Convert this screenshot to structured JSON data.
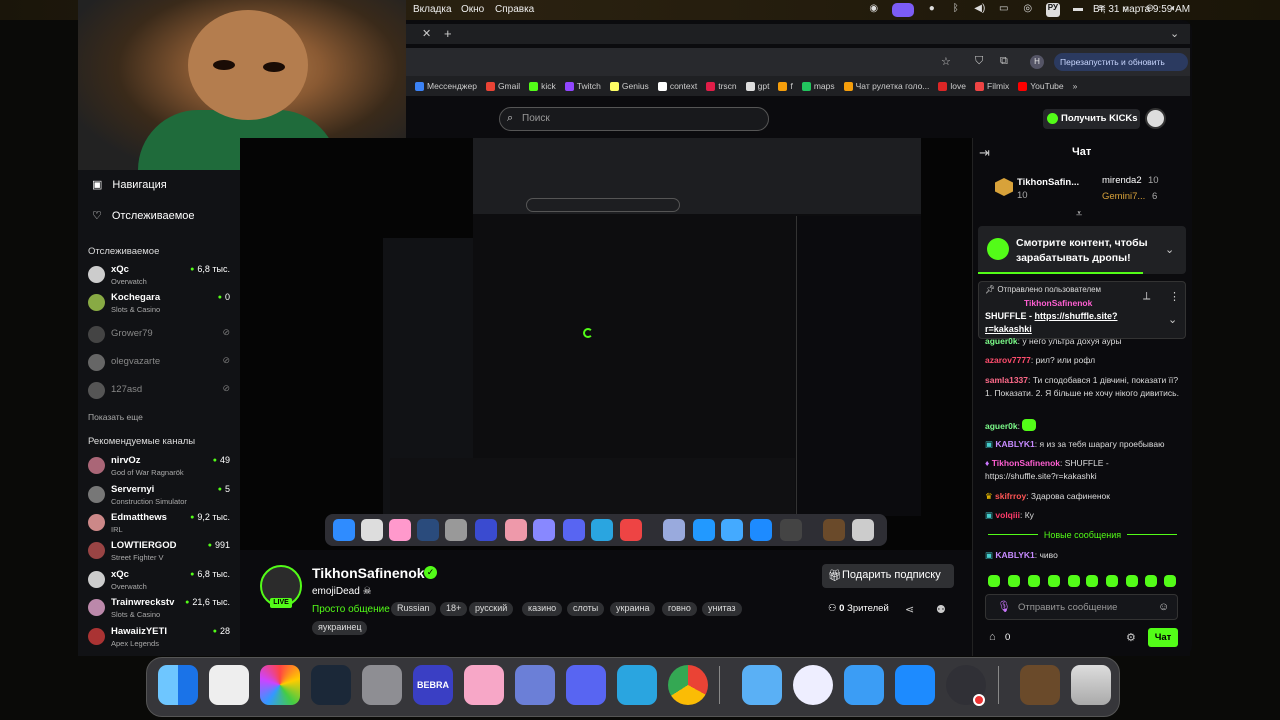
{
  "menubar": {
    "tab": "Вкладка",
    "window": "Окно",
    "help": "Справка",
    "lang": "РУ",
    "datetime": "Вт, 31 марта  9:59 AM"
  },
  "browser": {
    "restart_button": "Перезапустить и обновить",
    "bookmarks": [
      {
        "label": "Мессенджер",
        "color": "#3b82f6"
      },
      {
        "label": "Gmail",
        "color": "#ea4335"
      },
      {
        "label": "kick",
        "color": "#53fc18"
      },
      {
        "label": "Twitch",
        "color": "#9146ff"
      },
      {
        "label": "Genius",
        "color": "#ffff64"
      },
      {
        "label": "context",
        "color": "#ffffff"
      },
      {
        "label": "trscn",
        "color": "#e11d48"
      },
      {
        "label": "gpt",
        "color": "#dddddd"
      },
      {
        "label": "f",
        "color": "#f59e0b"
      },
      {
        "label": "maps",
        "color": "#22c55e"
      },
      {
        "label": "Чат рулетка голо...",
        "color": "#f59e0b"
      },
      {
        "label": "love",
        "color": "#dc2626"
      },
      {
        "label": "Filmix",
        "color": "#ef4444"
      },
      {
        "label": "YouTube",
        "color": "#ff0000"
      }
    ]
  },
  "kick": {
    "search_placeholder": "Поиск",
    "get_kicks": "Получить KICKs"
  },
  "sidebar": {
    "nav_label": "Навигация",
    "following_label": "Отслеживаемое",
    "following_title": "Отслеживаемое",
    "following": [
      {
        "name": "xQc",
        "game": "Overwatch",
        "viewers": "6,8 тыс."
      },
      {
        "name": "Kochegara",
        "game": "Slots & Casino",
        "viewers": "0"
      }
    ],
    "offline": [
      {
        "name": "Grower79"
      },
      {
        "name": "olegvazarte"
      },
      {
        "name": "127asd"
      }
    ],
    "show_more": "Показать еще",
    "recommended_title": "Рекомендуемые каналы",
    "recommended": [
      {
        "name": "nirvOz",
        "game": "God of War Ragnarök",
        "viewers": "49"
      },
      {
        "name": "Servernyi",
        "game": "Construction Simulator",
        "viewers": "5"
      },
      {
        "name": "Edmatthews",
        "game": "IRL",
        "viewers": "9,2 тыс."
      },
      {
        "name": "LOWTIERGOD",
        "game": "Street Fighter V",
        "viewers": "991"
      },
      {
        "name": "xQc",
        "game": "Overwatch",
        "viewers": "6,8 тыс."
      },
      {
        "name": "Trainwreckstv",
        "game": "Slots & Casino",
        "viewers": "21,6 тыс."
      },
      {
        "name": "HawaiizYETI",
        "game": "Apex Legends",
        "viewers": "28"
      }
    ]
  },
  "stream": {
    "name": "TikhonSafinenok",
    "title": "emojiDead ☠",
    "category": "Просто общение",
    "tags": [
      "Russian",
      "18+",
      "русский",
      "казино",
      "слоты",
      "украина",
      "говно",
      "унитаз",
      "яукраинец"
    ],
    "live": "LIVE",
    "subscribe": "Подарить подписку",
    "viewers_count": "0",
    "viewers_label": "Зрителей"
  },
  "chat": {
    "title": "Чат",
    "leaders": [
      {
        "name": "TikhonSafin...",
        "count": "10"
      },
      {
        "name": "mirenda2",
        "count": "10"
      },
      {
        "name": "Gemini7...",
        "count": "6"
      }
    ],
    "drops_text": "Смотрите контент, чтобы зарабатывать дропы!",
    "pinned_by": "Отправлено пользователем",
    "pinned_user": "TikhonSafinenok",
    "pinned_text": "SHUFFLE - ",
    "pinned_link": "https://shuffle.site?r=kakashki",
    "messages": [
      {
        "user": "aguer0k",
        "color": "#7cfc8a",
        "text": ": у него ультра дохуя ауры"
      },
      {
        "user": "azarov7777",
        "color": "#ff4d6d",
        "text": ": рил? или рофл"
      },
      {
        "user": "samla1337",
        "color": "#ff6b8a",
        "text": ": Ти сподобався 1 дівчині, показати її? 1. Показати. 2. Я більше не хочу нікого дивитись."
      },
      {
        "user": "aguer0k",
        "color": "#7cfc8a",
        "text": ":"
      },
      {
        "user": "KABLYK1",
        "color": "#c78bff",
        "text": ": я из за тебя шарагу проебываю"
      },
      {
        "user": "TikhonSafinenok",
        "color": "#ff5fd2",
        "text": ": SHUFFLE - https://shuffle.site?r=kakashki"
      },
      {
        "user": "skifrroy",
        "color": "#ff5555",
        "text": ": Здарова сафиненок"
      },
      {
        "user": "volqiii",
        "color": "#ff3b6b",
        "text": ": Ку"
      },
      {
        "user": "KABLYK1",
        "color": "#c78bff",
        "text": ": чиво"
      }
    ],
    "new_messages": "Новые сообщения",
    "input_placeholder": "Отправить сообщение",
    "points": "0",
    "send": "Чат"
  },
  "dock": {
    "apps": [
      "finder",
      "launchpad",
      "photos",
      "steam",
      "settings",
      "bebra",
      "presentation",
      "files",
      "discord",
      "telegram",
      "chrome",
      "obs-helper",
      "safari",
      "mail",
      "app-store",
      "obs",
      "chipmunk",
      "trash"
    ],
    "bebra_label": "BEBRA"
  }
}
